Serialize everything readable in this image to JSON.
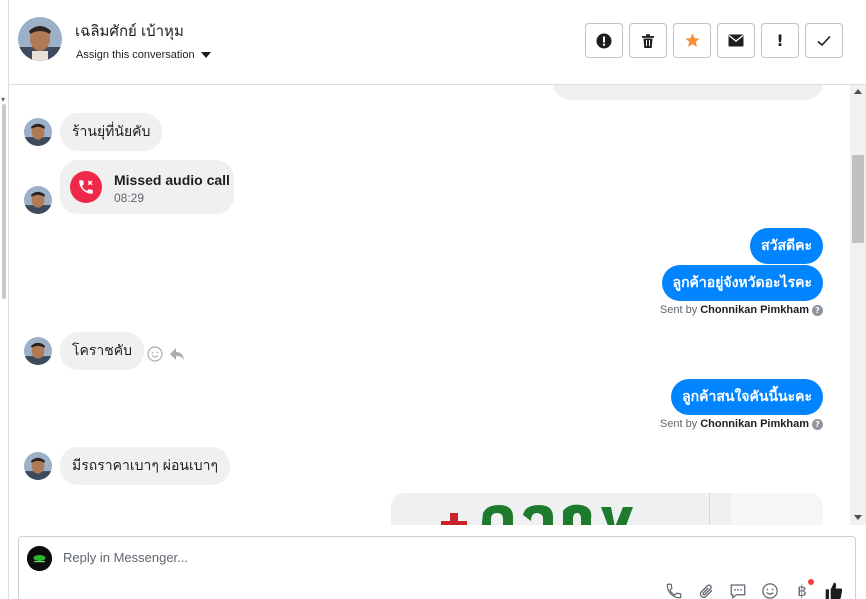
{
  "header": {
    "contact_name": "เฉลิมศักย์ เบ้าหุม",
    "assign_label": "Assign this conversation",
    "actions": [
      {
        "name": "spam",
        "icon": "alert-circle-icon"
      },
      {
        "name": "delete",
        "icon": "trash-icon"
      },
      {
        "name": "star",
        "icon": "star-icon"
      },
      {
        "name": "mark-unread",
        "icon": "envelope-icon"
      },
      {
        "name": "follow-up",
        "icon": "exclamation-icon"
      },
      {
        "name": "done",
        "icon": "check-icon"
      }
    ]
  },
  "messages": {
    "m1_text": "ร้านยุ่ที่นัยคับ",
    "call_title": "Missed audio call",
    "call_time": "08:29",
    "out1": "สวัสดีคะ",
    "out2": "ลูกค้าอยู่จังหวัดอะไรคะ",
    "sent_by_prefix": "Sent by",
    "sent_by_name": "Chonnikan Pimkham",
    "m2_text": "โคราชคับ",
    "out3": "ลูกค้าสนใจคันนี้นะคะ",
    "m3_text": "มีรถราคาเบาๆ  ผ่อนเบาๆ"
  },
  "composer": {
    "placeholder": "Reply in Messenger..."
  },
  "colors": {
    "outgoing_bubble": "#0084ff",
    "incoming_bubble": "#f0f0f0",
    "star": "#f7923b",
    "missed_call": "#f02849"
  }
}
